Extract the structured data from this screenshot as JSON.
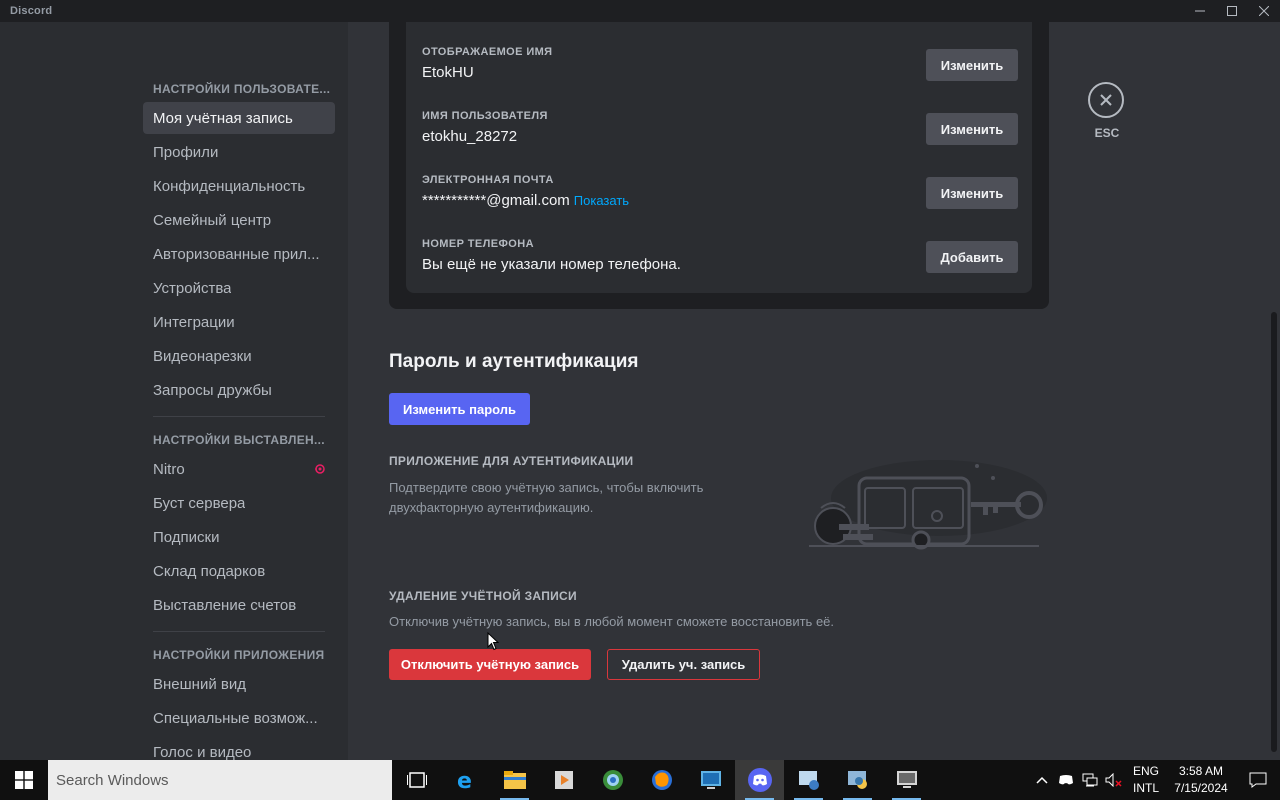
{
  "window": {
    "title": "Discord"
  },
  "sidebar": {
    "sections": [
      {
        "header": "НАСТРОЙКИ ПОЛЬЗОВАТЕ...",
        "items": [
          "Моя учётная запись",
          "Профили",
          "Конфиденциальность",
          "Семейный центр",
          "Авторизованные прил...",
          "Устройства",
          "Интеграции",
          "Видеонарезки",
          "Запросы дружбы"
        ]
      },
      {
        "header": "НАСТРОЙКИ ВЫСТАВЛЕН...",
        "items": [
          "Nitro",
          "Буст сервера",
          "Подписки",
          "Склад подарков",
          "Выставление счетов"
        ]
      },
      {
        "header": "НАСТРОЙКИ ПРИЛОЖЕНИЯ",
        "items": [
          "Внешний вид",
          "Специальные возмож...",
          "Голос и видео"
        ]
      }
    ],
    "active_item": "Моя учётная запись"
  },
  "account": {
    "display_name": {
      "label": "ОТОБРАЖАЕМОЕ ИМЯ",
      "value": "EtokHU",
      "button": "Изменить"
    },
    "username": {
      "label": "ИМЯ ПОЛЬЗОВАТЕЛЯ",
      "value": "etokhu_28272",
      "button": "Изменить"
    },
    "email": {
      "label": "ЭЛЕКТРОННАЯ ПОЧТА",
      "value": "***********@gmail.com",
      "show_link": "Показать",
      "button": "Изменить"
    },
    "phone": {
      "label": "НОМЕР ТЕЛЕФОНА",
      "value": "Вы ещё не указали номер телефона.",
      "button": "Добавить"
    }
  },
  "password_section": {
    "title": "Пароль и аутентификация",
    "change_password_button": "Изменить пароль",
    "auth_app_header": "ПРИЛОЖЕНИЕ ДЛЯ АУТЕНТИФИКАЦИИ",
    "auth_app_desc_line1": "Подтвердите свою учётную запись, чтобы включить",
    "auth_app_desc_line2": "двухфакторную аутентификацию."
  },
  "delete_section": {
    "header": "УДАЛЕНИЕ УЧЁТНОЙ ЗАПИСИ",
    "desc": "Отключив учётную запись, вы в любой момент сможете восстановить её.",
    "disable_button": "Отключить учётную запись",
    "delete_button": "Удалить уч. запись"
  },
  "close": {
    "label": "ESC"
  },
  "taskbar": {
    "search_placeholder": "Search Windows",
    "lang_line1": "ENG",
    "lang_line2": "INTL",
    "time": "3:58 AM",
    "date": "7/15/2024"
  },
  "colors": {
    "accent": "#5865f2",
    "danger": "#da373c",
    "link": "#00a8fc",
    "nitro": "#e91e63"
  }
}
